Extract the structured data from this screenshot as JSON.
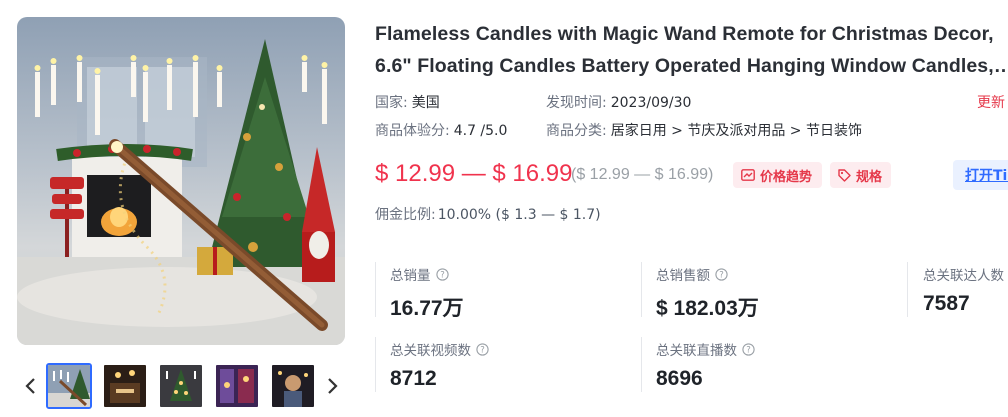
{
  "product": {
    "title_line1": "Flameless Candles with Magic Wand Remote for Christmas Decor,",
    "title_line2": "6.6\" Floating Candles Battery Operated Hanging Window Candles,…"
  },
  "meta": {
    "country_label": "国家:",
    "country_value": "美国",
    "found_label": "发现时间:",
    "found_value": "2023/09/30",
    "update_label": "更新",
    "score_label": "商品体验分:",
    "score_value": "4.7 /5.0",
    "category_label": "商品分类:",
    "category_value": "居家日用 > 节庆及派对用品 > 节日装饰"
  },
  "price": {
    "range": "$ 12.99 — $ 16.99",
    "original": "($ 12.99 — $ 16.99)",
    "trend_label": "价格趋势",
    "spec_label": "规格",
    "open_label": "打开Tik"
  },
  "commission": {
    "label": "佣金比例:",
    "value": "10.00%  ($ 1.3 — $ 1.7)"
  },
  "stats": [
    {
      "label": "总销量",
      "value": "16.77万"
    },
    {
      "label": "总销售额",
      "value": "$ 182.03万"
    },
    {
      "label": "总关联达人数",
      "value": "7587"
    },
    {
      "label": "总关联视频数",
      "value": "8712"
    },
    {
      "label": "总关联直播数",
      "value": "8696"
    }
  ],
  "icons": {
    "prev": "chevron-left-icon",
    "next": "chevron-right-icon",
    "info": "info-circle-icon",
    "trend": "chart-trend-icon",
    "tag": "tag-icon"
  },
  "colors": {
    "price_red": "#f0334d",
    "chip_bg": "#fdecef",
    "link_blue": "#2f6bff",
    "active_thumb": "#2f6bff"
  }
}
